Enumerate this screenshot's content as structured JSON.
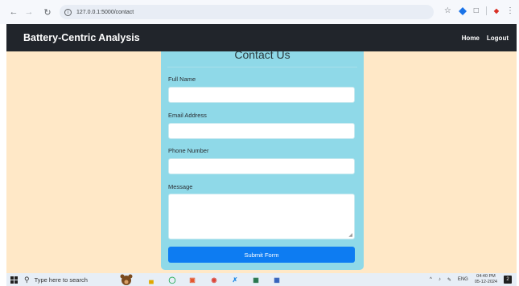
{
  "browser": {
    "url": "127.0.0.1:5000/contact"
  },
  "navbar": {
    "brand": "Battery-Centric Analysis",
    "links": [
      {
        "label": "Home"
      },
      {
        "label": "Logout"
      }
    ]
  },
  "form": {
    "title": "Contact Us",
    "fields": [
      {
        "label": "Full Name",
        "value": ""
      },
      {
        "label": "Email Address",
        "value": ""
      },
      {
        "label": "Phone Number",
        "value": ""
      },
      {
        "label": "Message",
        "value": ""
      }
    ],
    "submit_label": "Submit Form"
  },
  "taskbar": {
    "search_placeholder": "Type here to search",
    "apps": [
      "file-explorer-icon",
      "whatsapp-icon",
      "mail-icon",
      "chrome-icon",
      "vscode-icon",
      "excel-icon",
      "word-icon"
    ],
    "language": "ENG",
    "time": "04:40 PM",
    "date": "05-12-2024",
    "notification_count": "2"
  },
  "colors": {
    "page_bg": "#ffe8c7",
    "card_bg": "#8fd9e8",
    "navbar_bg": "#21252b",
    "submit_bg": "#0d7cf2"
  }
}
